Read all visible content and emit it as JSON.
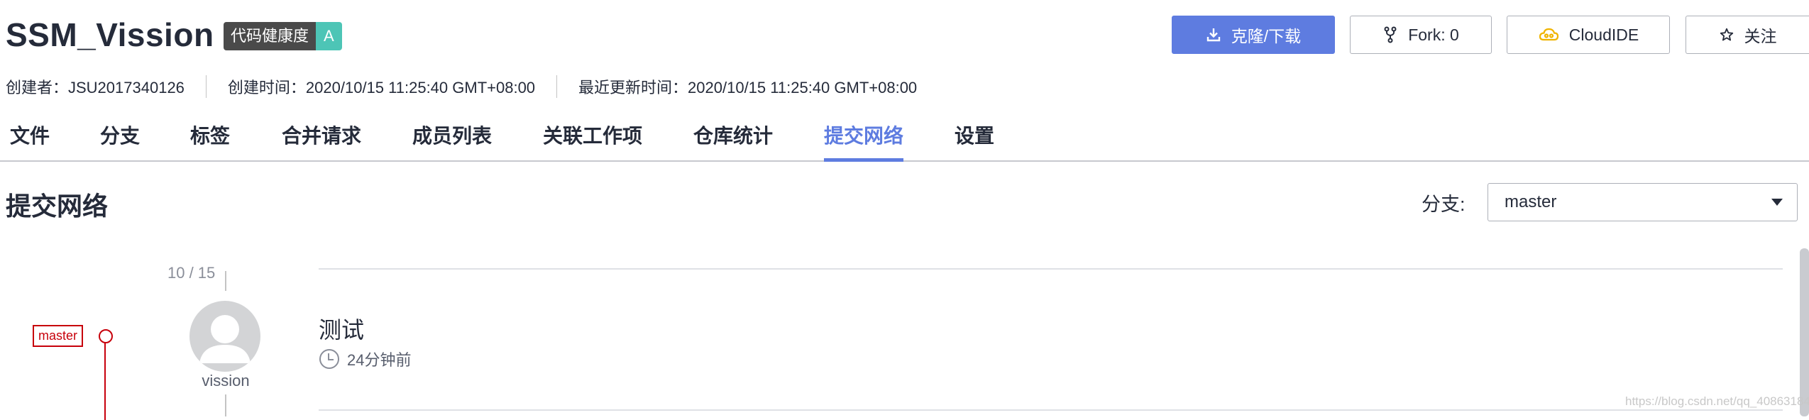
{
  "repo": {
    "name": "SSM_Vission",
    "health_label": "代码健康度",
    "health_grade": "A"
  },
  "actions": {
    "clone_label": "克隆/下载",
    "fork_label": "Fork: 0",
    "cloudide_label": "CloudIDE",
    "follow_label": "关注"
  },
  "meta": {
    "creator": "创建者：JSU2017340126",
    "created": "创建时间：2020/10/15 11:25:40 GMT+08:00",
    "updated": "最近更新时间：2020/10/15 11:25:40 GMT+08:00"
  },
  "tabs": [
    {
      "label": "文件"
    },
    {
      "label": "分支"
    },
    {
      "label": "标签"
    },
    {
      "label": "合并请求"
    },
    {
      "label": "成员列表"
    },
    {
      "label": "关联工作项"
    },
    {
      "label": "仓库统计"
    },
    {
      "label": "提交网络"
    },
    {
      "label": "设置"
    }
  ],
  "active_tab": "提交网络",
  "section": {
    "title": "提交网络",
    "branch_label": "分支:",
    "branch_value": "master"
  },
  "graph": {
    "date": "10 / 15",
    "branch_tag": "master",
    "author": "vission",
    "commit_message": "测试",
    "commit_time": "24分钟前"
  },
  "watermark": "https://blog.csdn.net/qq_40863184",
  "colors": {
    "primary": "#5e7ce0",
    "branch_red": "#c7000b",
    "health_green": "#4dc5b6",
    "text": "#252b3a"
  },
  "icons": {
    "clone": "download-icon",
    "fork": "fork-icon",
    "cloudide": "cloud-icon",
    "follow": "star-icon",
    "time": "clock-icon"
  }
}
